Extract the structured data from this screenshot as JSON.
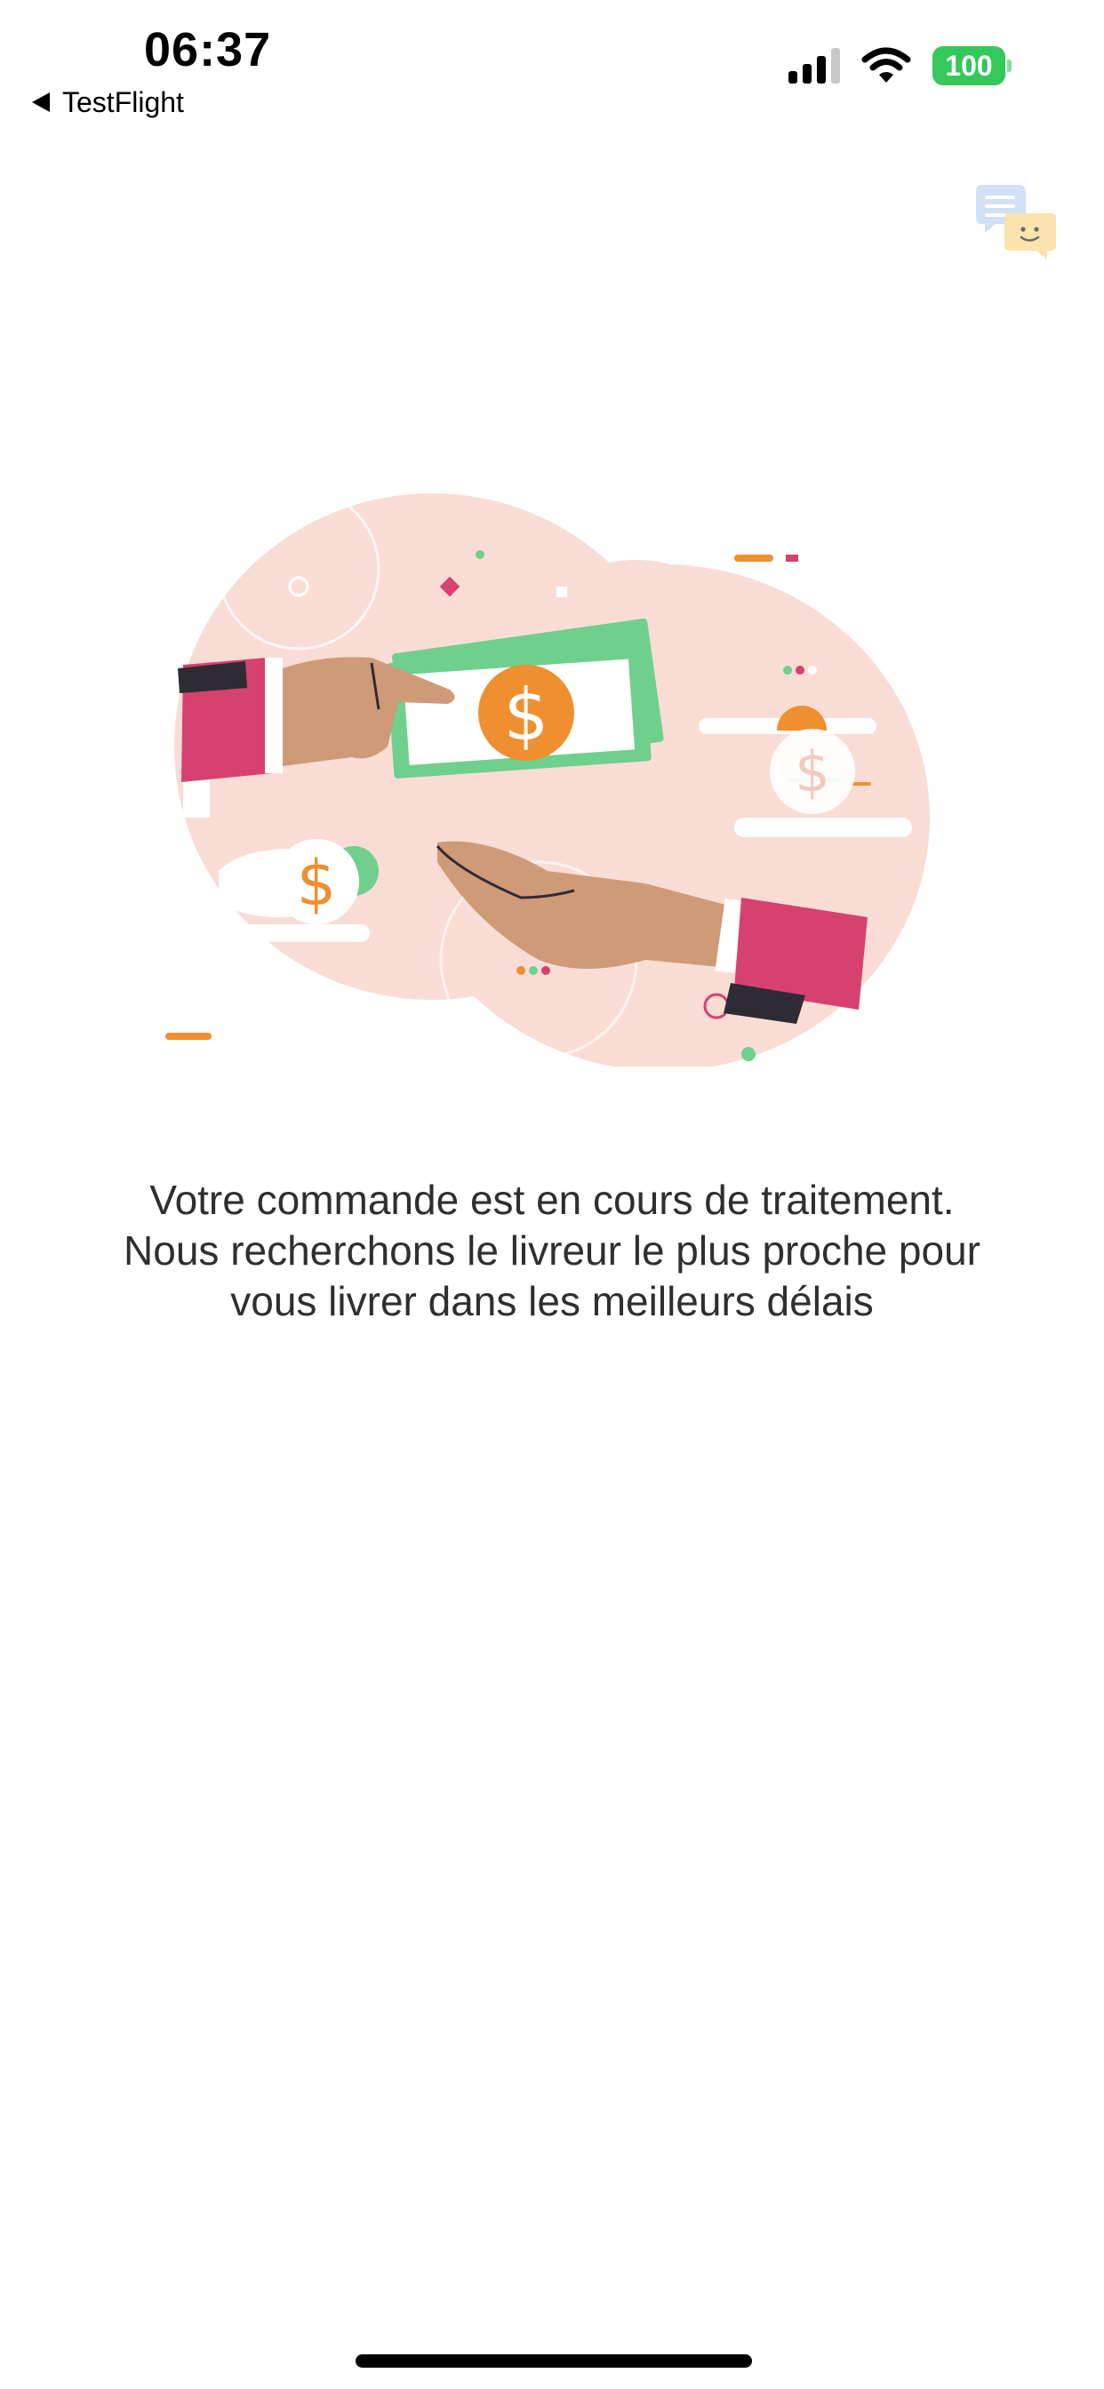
{
  "status_bar": {
    "time": "06:37",
    "back_app": "TestFlight",
    "battery": "100"
  },
  "message": {
    "line1": "Votre commande est en cours de traitement.",
    "line2": "Nous recherchons le livreur le plus proche pour",
    "line3": "vous livrer dans les meilleurs délais"
  },
  "icons": {
    "chat": "chat-bubbles-icon",
    "signal": "cellular-signal-icon",
    "wifi": "wifi-icon",
    "battery": "battery-icon",
    "back": "back-triangle-icon"
  },
  "colors": {
    "accent_green": "#34c759",
    "illustration_bg": "#f9ddd5",
    "money_green": "#6fcf8d",
    "coin_orange": "#ef8f2f",
    "sleeve_pink": "#d6416f"
  }
}
